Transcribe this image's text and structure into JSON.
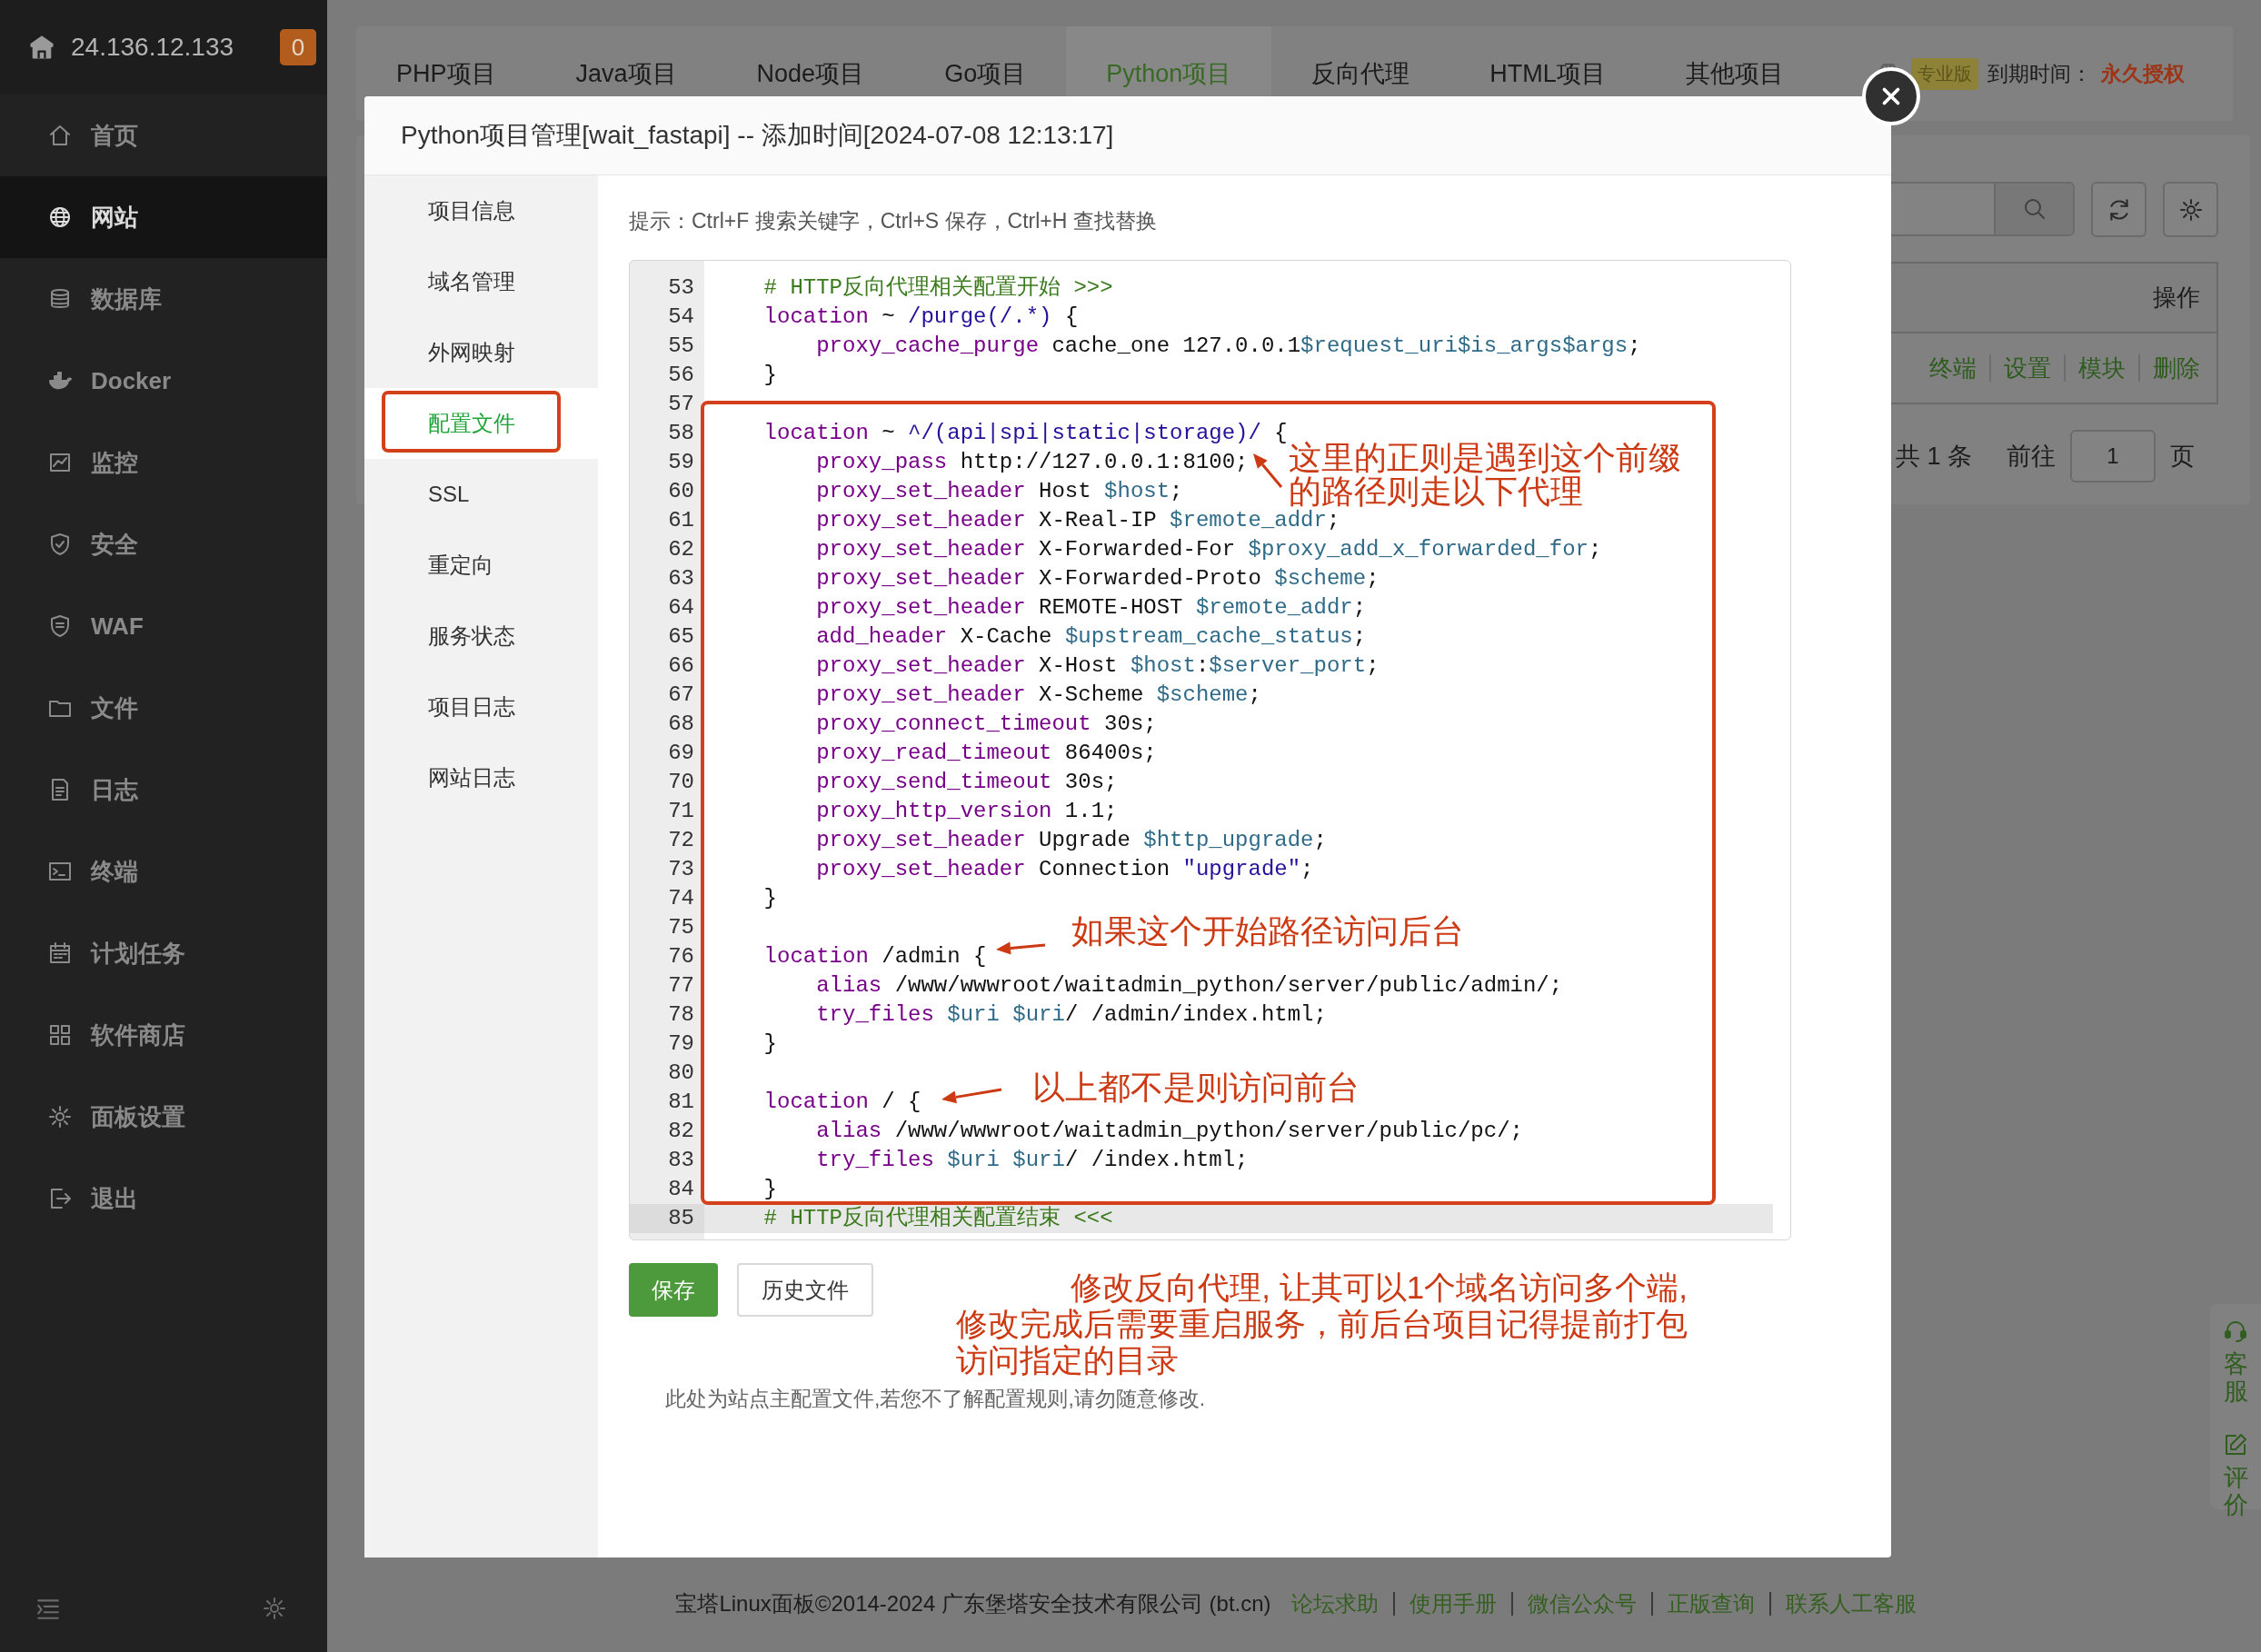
{
  "sidebar": {
    "host": "24.136.12.133",
    "badge": "0",
    "items": [
      {
        "label": "首页",
        "selected": false
      },
      {
        "label": "网站",
        "selected": true
      },
      {
        "label": "数据库",
        "selected": false
      },
      {
        "label": "Docker",
        "selected": false
      },
      {
        "label": "监控",
        "selected": false
      },
      {
        "label": "安全",
        "selected": false
      },
      {
        "label": "WAF",
        "selected": false
      },
      {
        "label": "文件",
        "selected": false
      },
      {
        "label": "日志",
        "selected": false
      },
      {
        "label": "终端",
        "selected": false
      },
      {
        "label": "计划任务",
        "selected": false
      },
      {
        "label": "软件商店",
        "selected": false
      },
      {
        "label": "面板设置",
        "selected": false
      },
      {
        "label": "退出",
        "selected": false
      }
    ]
  },
  "project_tabs": [
    {
      "label": "PHP项目",
      "selected": false
    },
    {
      "label": "Java项目",
      "selected": false
    },
    {
      "label": "Node项目",
      "selected": false
    },
    {
      "label": "Go项目",
      "selected": false
    },
    {
      "label": "Python项目",
      "selected": true
    },
    {
      "label": "反向代理",
      "selected": false
    },
    {
      "label": "HTML项目",
      "selected": false
    },
    {
      "label": "其他项目",
      "selected": false
    }
  ],
  "license": {
    "edition": "专业版",
    "expiry_label": "到期时间：",
    "expiry_value": "永久授权"
  },
  "list_panel": {
    "column_header": "操作",
    "row_actions": [
      "终端",
      "设置",
      "模块",
      "删除"
    ],
    "pagination": {
      "total": "共 1 条",
      "goto_label": "前往",
      "page": "1",
      "page_unit": "页"
    }
  },
  "side_widget": [
    "客服",
    "评价"
  ],
  "modal": {
    "title": "Python项目管理[wait_fastapi] -- 添加时间[2024-07-08 12:13:17]",
    "nav": [
      {
        "label": "项目信息",
        "selected": false
      },
      {
        "label": "域名管理",
        "selected": false
      },
      {
        "label": "外网映射",
        "selected": false
      },
      {
        "label": "配置文件",
        "selected": true
      },
      {
        "label": "SSL",
        "selected": false
      },
      {
        "label": "重定向",
        "selected": false
      },
      {
        "label": "服务状态",
        "selected": false
      },
      {
        "label": "项目日志",
        "selected": false
      },
      {
        "label": "网站日志",
        "selected": false
      }
    ],
    "hint": "提示：Ctrl+F 搜索关键字，Ctrl+S 保存，Ctrl+H 查找替换",
    "code_lines": [
      {
        "number": "53",
        "active": false,
        "tokens": [
          {
            "kind": "comment",
            "text": "    # HTTP反向代理相关配置开始 >>>"
          }
        ]
      },
      {
        "number": "54",
        "active": false,
        "tokens": [
          {
            "kind": "keyword",
            "text": "    location"
          },
          {
            "kind": "plain",
            "text": " ~ "
          },
          {
            "kind": "string",
            "text": "/purge(/.*)"
          },
          {
            "kind": "plain",
            "text": " {"
          }
        ]
      },
      {
        "number": "55",
        "active": false,
        "tokens": [
          {
            "kind": "keyword",
            "text": "        proxy_cache_purge"
          },
          {
            "kind": "plain",
            "text": " cache_one 127.0.0.1"
          },
          {
            "kind": "variable",
            "text": "$request_uri$is_args$args"
          },
          {
            "kind": "plain",
            "text": ";"
          }
        ]
      },
      {
        "number": "56",
        "active": false,
        "tokens": [
          {
            "kind": "plain",
            "text": "    }"
          }
        ]
      },
      {
        "number": "57",
        "active": false
      },
      {
        "number": "58",
        "active": false,
        "tokens": [
          {
            "kind": "keyword",
            "text": "    location"
          },
          {
            "kind": "plain",
            "text": " ~ "
          },
          {
            "kind": "string",
            "text": "^/(api|spi|static|storage)/"
          },
          {
            "kind": "plain",
            "text": " {"
          }
        ]
      },
      {
        "number": "59",
        "active": false,
        "tokens": [
          {
            "kind": "keyword",
            "text": "        proxy_pass"
          },
          {
            "kind": "plain",
            "text": " http://127.0.0.1:8100;"
          }
        ]
      },
      {
        "number": "60",
        "active": false,
        "tokens": [
          {
            "kind": "keyword",
            "text": "        proxy_set_header"
          },
          {
            "kind": "plain",
            "text": " Host "
          },
          {
            "kind": "variable",
            "text": "$host"
          },
          {
            "kind": "plain",
            "text": ";"
          }
        ]
      },
      {
        "number": "61",
        "active": false,
        "tokens": [
          {
            "kind": "keyword",
            "text": "        proxy_set_header"
          },
          {
            "kind": "plain",
            "text": " X-Real-IP "
          },
          {
            "kind": "variable",
            "text": "$remote_addr"
          },
          {
            "kind": "plain",
            "text": ";"
          }
        ]
      },
      {
        "number": "62",
        "active": false,
        "tokens": [
          {
            "kind": "keyword",
            "text": "        proxy_set_header"
          },
          {
            "kind": "plain",
            "text": " X-Forwarded-For "
          },
          {
            "kind": "variable",
            "text": "$proxy_add_x_forwarded_for"
          },
          {
            "kind": "plain",
            "text": ";"
          }
        ]
      },
      {
        "number": "63",
        "active": false,
        "tokens": [
          {
            "kind": "keyword",
            "text": "        proxy_set_header"
          },
          {
            "kind": "plain",
            "text": " X-Forwarded-Proto "
          },
          {
            "kind": "variable",
            "text": "$scheme"
          },
          {
            "kind": "plain",
            "text": ";"
          }
        ]
      },
      {
        "number": "64",
        "active": false,
        "tokens": [
          {
            "kind": "keyword",
            "text": "        proxy_set_header"
          },
          {
            "kind": "plain",
            "text": " REMOTE-HOST "
          },
          {
            "kind": "variable",
            "text": "$remote_addr"
          },
          {
            "kind": "plain",
            "text": ";"
          }
        ]
      },
      {
        "number": "65",
        "active": false,
        "tokens": [
          {
            "kind": "keyword",
            "text": "        add_header"
          },
          {
            "kind": "plain",
            "text": " X-Cache "
          },
          {
            "kind": "variable",
            "text": "$upstream_cache_status"
          },
          {
            "kind": "plain",
            "text": ";"
          }
        ]
      },
      {
        "number": "66",
        "active": false,
        "tokens": [
          {
            "kind": "keyword",
            "text": "        proxy_set_header"
          },
          {
            "kind": "plain",
            "text": " X-Host "
          },
          {
            "kind": "variable",
            "text": "$host"
          },
          {
            "kind": "plain",
            "text": ":"
          },
          {
            "kind": "variable",
            "text": "$server_port"
          },
          {
            "kind": "plain",
            "text": ";"
          }
        ]
      },
      {
        "number": "67",
        "active": false,
        "tokens": [
          {
            "kind": "keyword",
            "text": "        proxy_set_header"
          },
          {
            "kind": "plain",
            "text": " X-Scheme "
          },
          {
            "kind": "variable",
            "text": "$scheme"
          },
          {
            "kind": "plain",
            "text": ";"
          }
        ]
      },
      {
        "number": "68",
        "active": false,
        "tokens": [
          {
            "kind": "keyword",
            "text": "        proxy_connect_timeout"
          },
          {
            "kind": "plain",
            "text": " 30s;"
          }
        ]
      },
      {
        "number": "69",
        "active": false,
        "tokens": [
          {
            "kind": "keyword",
            "text": "        proxy_read_timeout"
          },
          {
            "kind": "plain",
            "text": " 86400s;"
          }
        ]
      },
      {
        "number": "70",
        "active": false,
        "tokens": [
          {
            "kind": "keyword",
            "text": "        proxy_send_timeout"
          },
          {
            "kind": "plain",
            "text": " 30s;"
          }
        ]
      },
      {
        "number": "71",
        "active": false,
        "tokens": [
          {
            "kind": "keyword",
            "text": "        proxy_http_version"
          },
          {
            "kind": "plain",
            "text": " 1.1;"
          }
        ]
      },
      {
        "number": "72",
        "active": false,
        "tokens": [
          {
            "kind": "keyword",
            "text": "        proxy_set_header"
          },
          {
            "kind": "plain",
            "text": " Upgrade "
          },
          {
            "kind": "variable",
            "text": "$http_upgrade"
          },
          {
            "kind": "plain",
            "text": ";"
          }
        ]
      },
      {
        "number": "73",
        "active": false,
        "tokens": [
          {
            "kind": "keyword",
            "text": "        proxy_set_header"
          },
          {
            "kind": "plain",
            "text": " Connection "
          },
          {
            "kind": "string",
            "text": "\"upgrade\""
          },
          {
            "kind": "plain",
            "text": ";"
          }
        ]
      },
      {
        "number": "74",
        "active": false,
        "tokens": [
          {
            "kind": "plain",
            "text": "    }"
          }
        ]
      },
      {
        "number": "75",
        "active": false
      },
      {
        "number": "76",
        "active": false,
        "tokens": [
          {
            "kind": "keyword",
            "text": "    location"
          },
          {
            "kind": "plain",
            "text": " /admin {"
          }
        ]
      },
      {
        "number": "77",
        "active": false,
        "tokens": [
          {
            "kind": "keyword",
            "text": "        alias"
          },
          {
            "kind": "plain",
            "text": " /www/wwwroot/waitadmin_python/server/public/admin/;"
          }
        ]
      },
      {
        "number": "78",
        "active": false,
        "tokens": [
          {
            "kind": "keyword",
            "text": "        try_files"
          },
          {
            "kind": "variable",
            "text": " $uri"
          },
          {
            "kind": "variable",
            "text": " $uri"
          },
          {
            "kind": "plain",
            "text": "/ /admin/index.html;"
          }
        ]
      },
      {
        "number": "79",
        "active": false,
        "tokens": [
          {
            "kind": "plain",
            "text": "    }"
          }
        ]
      },
      {
        "number": "80",
        "active": false
      },
      {
        "number": "81",
        "active": false,
        "tokens": [
          {
            "kind": "keyword",
            "text": "    location"
          },
          {
            "kind": "plain",
            "text": " / {"
          }
        ]
      },
      {
        "number": "82",
        "active": false,
        "tokens": [
          {
            "kind": "keyword",
            "text": "        alias"
          },
          {
            "kind": "plain",
            "text": " /www/wwwroot/waitadmin_python/server/public/pc/;"
          }
        ]
      },
      {
        "number": "83",
        "active": false,
        "tokens": [
          {
            "kind": "keyword",
            "text": "        try_files"
          },
          {
            "kind": "variable",
            "text": " $uri"
          },
          {
            "kind": "variable",
            "text": " $uri"
          },
          {
            "kind": "plain",
            "text": "/ /index.html;"
          }
        ]
      },
      {
        "number": "84",
        "active": false,
        "tokens": [
          {
            "kind": "plain",
            "text": "    }"
          }
        ]
      },
      {
        "number": "85",
        "active": true,
        "tokens": [
          {
            "kind": "comment",
            "text": "    # HTTP反向代理相关配置结束 <<<"
          }
        ]
      }
    ],
    "buttons": [
      {
        "label": "保存",
        "kind": "primary"
      },
      {
        "label": "历史文件",
        "kind": "default"
      }
    ],
    "warning": "此处为站点主配置文件,若您不了解配置规则,请勿随意修改.",
    "note": {
      "lines": [
        "修改反向代理, 让其可以1个域名访问多个端,",
        "修改完成后需要重启服务，前后台项目记得提前打包",
        "访问指定的目录"
      ]
    }
  },
  "annotations": [
    {
      "lines": [
        "这里的正则是遇到这个前缀",
        "的路径则走以下代理"
      ]
    },
    {
      "lines": [
        "如果这个开始路径访问后台"
      ]
    },
    {
      "lines": [
        "以上都不是则访问前台"
      ]
    }
  ],
  "footer": {
    "copyright": "宝塔Linux面板©2014-2024 广东堡塔安全技术有限公司 (bt.cn)",
    "links": [
      "论坛求助",
      "使用手册",
      "微信公众号",
      "正版查询",
      "联系人工客服"
    ]
  }
}
